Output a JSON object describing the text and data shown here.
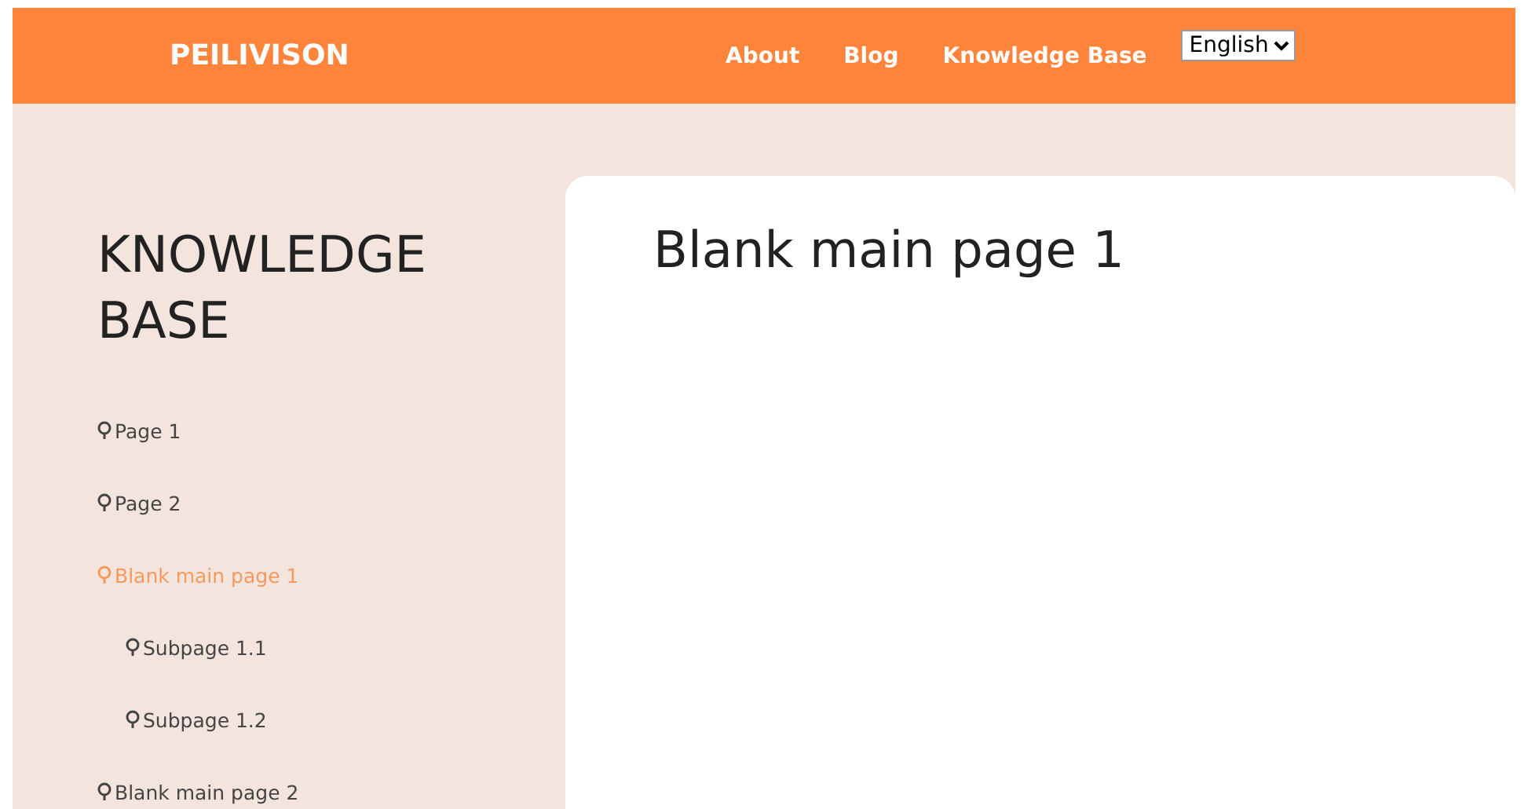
{
  "header": {
    "brand": "PEILIVISON",
    "nav": [
      {
        "label": "About"
      },
      {
        "label": "Blog"
      },
      {
        "label": "Knowledge Base"
      }
    ],
    "language": "English"
  },
  "sidebar": {
    "title": "KNOWLEDGE BASE",
    "items": [
      {
        "label": "Page 1",
        "selected": false
      },
      {
        "label": "Page 2",
        "selected": false
      },
      {
        "label": "Blank main page 1",
        "selected": true,
        "children": [
          {
            "label": "Subpage 1.1",
            "selected": false
          },
          {
            "label": "Subpage 1.2",
            "selected": false
          }
        ]
      },
      {
        "label": "Blank main page 2",
        "selected": false
      }
    ]
  },
  "content": {
    "title": "Blank main page 1"
  }
}
